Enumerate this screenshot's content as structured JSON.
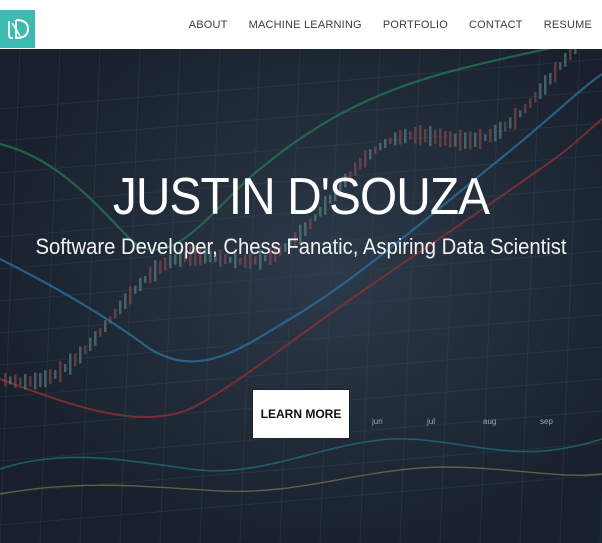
{
  "logo": {
    "text": "JD",
    "color": "#3cbcb0"
  },
  "nav": {
    "items": [
      {
        "label": "ABOUT"
      },
      {
        "label": "MACHINE LEARNING"
      },
      {
        "label": "PORTFOLIO"
      },
      {
        "label": "CONTACT"
      },
      {
        "label": "RESUME"
      }
    ]
  },
  "hero": {
    "title": "JUSTIN D'SOUZA",
    "subtitle": "Software Developer, Chess Fanatic, Aspiring Data Scientist",
    "cta_label": "LEARN MORE",
    "background": "stock-chart-image",
    "bg_axis_labels": [
      "jun",
      "jul",
      "aug",
      "sep"
    ]
  }
}
